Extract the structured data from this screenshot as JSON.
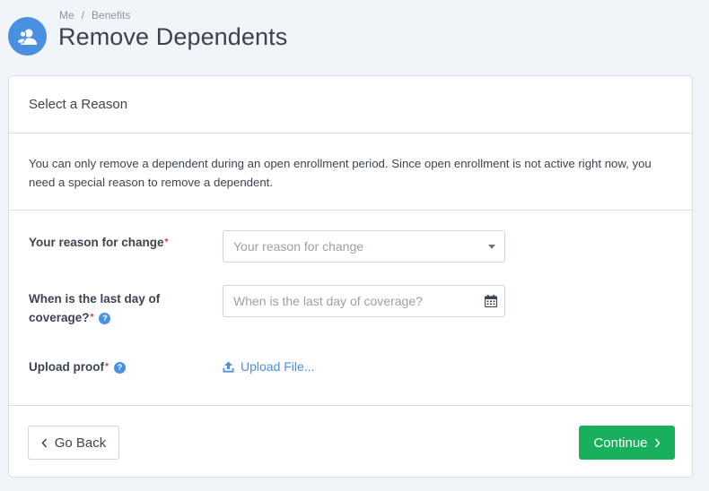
{
  "breadcrumb": {
    "items": [
      "Me",
      "Benefits"
    ],
    "separator": "/"
  },
  "page": {
    "title": "Remove Dependents",
    "icon": "people-icon"
  },
  "card": {
    "header": "Select a Reason",
    "intro": "You can only remove a dependent during an open enrollment period. Since open enrollment is not active right now, you need a special reason to remove a dependent."
  },
  "form": {
    "reason": {
      "label": "Your reason for change",
      "required_mark": "*",
      "placeholder": "Your reason for change"
    },
    "last_day": {
      "label_line1": "When is the last day of",
      "label_line2": "coverage?",
      "required_mark": "*",
      "help": "?",
      "placeholder": "When is the last day of coverage?"
    },
    "proof": {
      "label": "Upload proof",
      "required_mark": "*",
      "help": "?",
      "upload_label": "Upload File..."
    }
  },
  "footer": {
    "back_label": "Go Back",
    "continue_label": "Continue"
  },
  "colors": {
    "accent": "#4a90e2",
    "success": "#19b05d",
    "required": "#e0313c"
  }
}
